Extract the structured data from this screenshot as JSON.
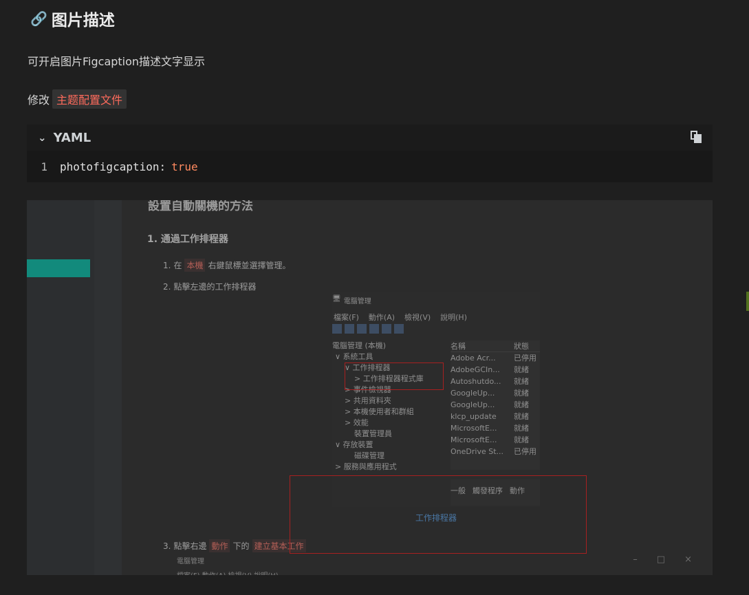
{
  "heading": {
    "icon": "link-icon",
    "text": "图片描述"
  },
  "paragraph1": "可开启图片Figcaption描述文字显示",
  "paragraph2": {
    "prefix": "修改",
    "code": "主题配置文件"
  },
  "codeblock": {
    "lang": "YAML",
    "lines": [
      {
        "num": "1",
        "key": "photofigcaption:",
        "value": "true"
      }
    ]
  },
  "screenshot": {
    "title": "設置自動關機的方法",
    "section": "1. 通過工作排程器",
    "steps": [
      {
        "num": "1.",
        "pre": "在",
        "tag": "本機",
        "post": "右鍵鼠標並選擇管理。"
      },
      {
        "num": "2.",
        "text": "點擊左邊的工作排程器"
      },
      {
        "num": "3.",
        "pre": "點擊右邊",
        "tag": "動作",
        "mid": "下的",
        "tag2": "建立基本工作"
      }
    ],
    "caption": "工作排程器",
    "mgmt": {
      "window_title": "電腦管理",
      "menu": [
        "檔案(F)",
        "動作(A)",
        "檢視(V)",
        "說明(H)"
      ],
      "tree": [
        "電腦管理 (本機)",
        "∨ 系統工具",
        "∨ 工作排程器",
        "> 工作排程器程式庫",
        "> 事件檢視器",
        "> 共用資料夾",
        "> 本機使用者和群組",
        "> 效能",
        "裝置管理員",
        "∨ 存放裝置",
        "磁碟管理",
        "> 服務與應用程式"
      ],
      "list_headers": [
        "名稱",
        "狀態"
      ],
      "list": [
        [
          "Adobe Acr...",
          "已停用"
        ],
        [
          "AdobeGCIn...",
          "就緒"
        ],
        [
          "Autoshutdo...",
          "就緒"
        ],
        [
          "GoogleUp...",
          "就緒"
        ],
        [
          "GoogleUp...",
          "就緒"
        ],
        [
          "klcp_update",
          "就緒"
        ],
        [
          "MicrosoftE...",
          "就緒"
        ],
        [
          "MicrosoftE...",
          "就緒"
        ],
        [
          "OneDrive St...",
          "已停用"
        ]
      ],
      "bottom_tabs": [
        "一般",
        "觸發程序",
        "動作"
      ]
    },
    "mgmt2_title": "電腦管理",
    "mgmt2_menu": "檔案(F)  動作(A)  檢視(V)  說明(H)",
    "window_controls": [
      "–",
      "□",
      "×"
    ]
  }
}
